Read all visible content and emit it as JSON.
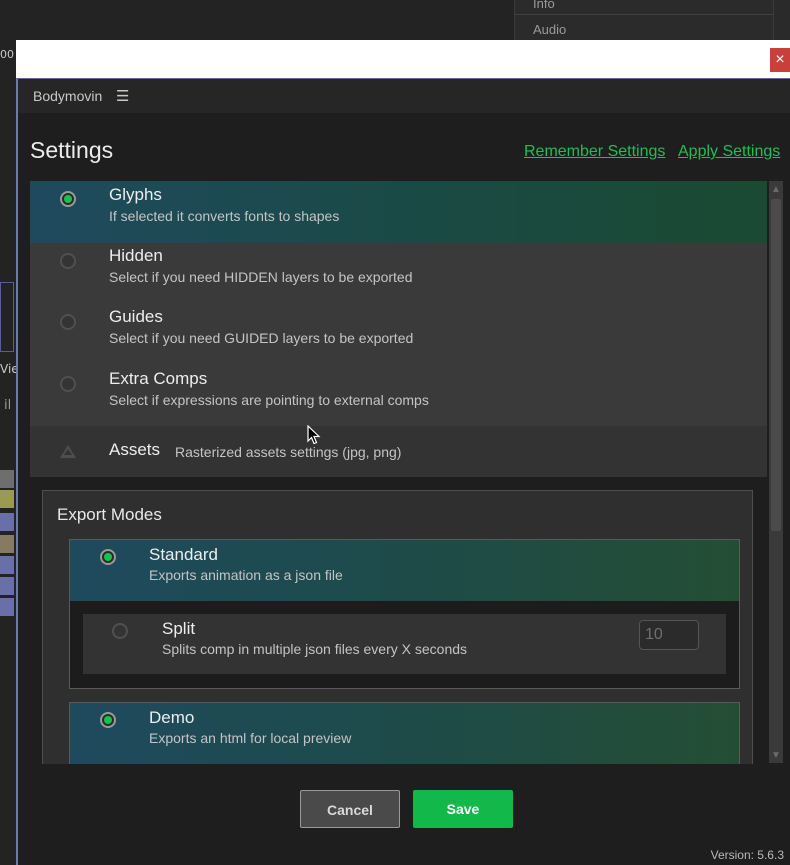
{
  "host": {
    "panel_rows": [
      "Info",
      "Audio"
    ],
    "fragments": [
      "00",
      "Vie",
      "il"
    ]
  },
  "window": {
    "close_label": "×"
  },
  "header": {
    "app_title": "Bodymovin",
    "menu_icon": "hamburger-icon"
  },
  "page": {
    "title": "Settings",
    "remember_label": "Remember Settings",
    "apply_label": "Apply Settings"
  },
  "settings": {
    "items": [
      {
        "title": "Glyphs",
        "desc": "If selected it converts fonts to shapes",
        "selected": true
      },
      {
        "title": "Hidden",
        "desc": "Select if you need HIDDEN layers to be exported",
        "selected": false
      },
      {
        "title": "Guides",
        "desc": "Select if you need GUIDED layers to be exported",
        "selected": false
      },
      {
        "title": "Extra Comps",
        "desc": "Select if expressions are pointing to external comps",
        "selected": false
      }
    ],
    "assets": {
      "title": "Assets",
      "desc": "Rasterized assets settings (jpg, png)"
    }
  },
  "export": {
    "title": "Export Modes",
    "standard": {
      "title": "Standard",
      "desc": "Exports animation as a json file",
      "selected": true
    },
    "split": {
      "title": "Split",
      "desc": "Splits comp in multiple json files every X seconds",
      "selected": false,
      "value": "10"
    },
    "demo": {
      "title": "Demo",
      "desc": "Exports an html for local preview",
      "selected": true
    }
  },
  "scrollbar": {
    "up": "▲",
    "down": "▼"
  },
  "footer": {
    "cancel_label": "Cancel",
    "save_label": "Save",
    "version": "Version: 5.6.3"
  },
  "colors": {
    "accent_green": "#16c44d",
    "link_green": "#1fbf52",
    "save_button": "#12b84a",
    "close_button": "#c9403a"
  }
}
